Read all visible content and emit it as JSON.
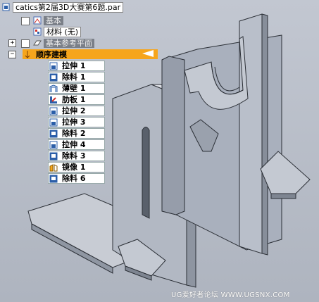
{
  "tree": {
    "root": {
      "label": "catics第2届3D大赛第6题.par"
    },
    "nodes": [
      {
        "label": "基本",
        "style": "gray"
      },
      {
        "label": "材料 (无)",
        "style": "white"
      },
      {
        "label": "基本参考平面",
        "style": "gray",
        "expander": "+"
      },
      {
        "label": "顺序建模",
        "style": "orange",
        "expander": "−"
      }
    ],
    "features": [
      {
        "label": "拉伸 1",
        "icon": "extrude-icon"
      },
      {
        "label": "除料 1",
        "icon": "cut-icon"
      },
      {
        "label": "薄壁 1",
        "icon": "thinwall-icon"
      },
      {
        "label": "肋板 1",
        "icon": "rib-icon"
      },
      {
        "label": "拉伸 2",
        "icon": "extrude-icon"
      },
      {
        "label": "拉伸 3",
        "icon": "extrude-icon"
      },
      {
        "label": "除料 2",
        "icon": "cut-icon"
      },
      {
        "label": "拉伸 4",
        "icon": "extrude-icon"
      },
      {
        "label": "除料 3",
        "icon": "cut-icon"
      },
      {
        "label": "镜像 1",
        "icon": "mirror-icon"
      },
      {
        "label": "除料 6",
        "icon": "cut-icon"
      }
    ]
  },
  "watermark": "UG爱好者论坛 WWW.UGSNX.COM",
  "colors": {
    "background": "#b9bfca",
    "selection": "#f6a51c",
    "feature_icon_blue": "#2b5ea8",
    "model_face": "#a9b0bd"
  }
}
